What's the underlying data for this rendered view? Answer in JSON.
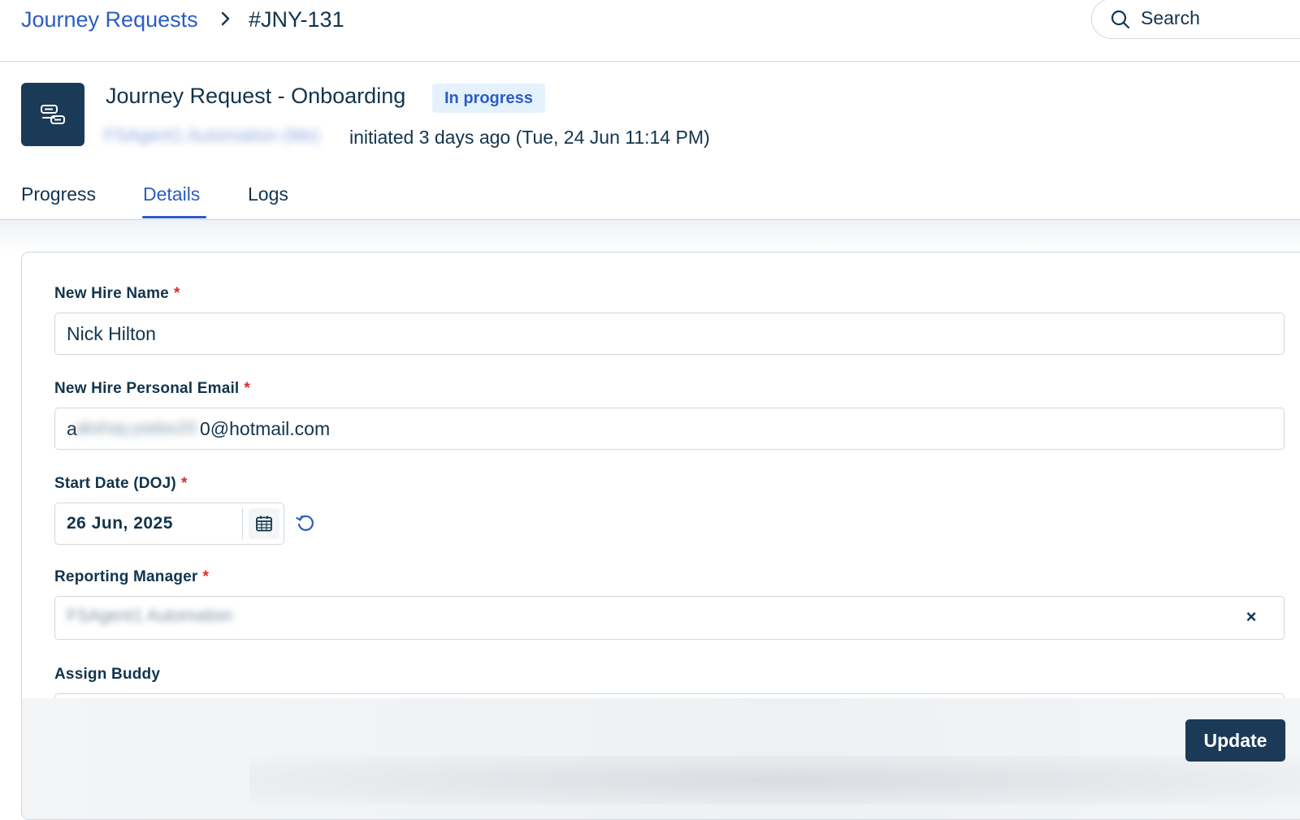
{
  "breadcrumb": {
    "parent": "Journey Requests",
    "current": "#JNY-131"
  },
  "search": {
    "placeholder": "Search"
  },
  "request": {
    "icon": "journey-request-icon",
    "title": "Journey Request - Onboarding",
    "status": "In progress",
    "initiator_blurred": "FSAgent1 Automation (Me)",
    "meta": "initiated 3 days ago (Tue, 24 Jun 11:14 PM)"
  },
  "tabs": [
    {
      "label": "Progress",
      "active": false
    },
    {
      "label": "Details",
      "active": true
    },
    {
      "label": "Logs",
      "active": false
    }
  ],
  "form": {
    "new_hire_name": {
      "label": "New Hire Name",
      "required": "*",
      "value": "Nick Hilton"
    },
    "personal_email": {
      "label": "New Hire Personal Email",
      "required": "*",
      "value_first": "a",
      "value_blurred": "akshay.yadav20",
      "value_rest": "0@hotmail.com"
    },
    "start_date": {
      "label": "Start Date (DOJ)",
      "required": "*",
      "value": "26 Jun, 2025"
    },
    "reporting_manager": {
      "label": "Reporting Manager",
      "required": "*",
      "value_blurred": "FSAgent1 Automation",
      "clear": "×"
    },
    "assign_buddy": {
      "label": "Assign Buddy"
    }
  },
  "footer": {
    "update_label": "Update"
  },
  "colors": {
    "primary": "#1b3a57",
    "link": "#2c5cc5",
    "required": "#d72d30",
    "badge_bg": "#e5f2fd"
  }
}
